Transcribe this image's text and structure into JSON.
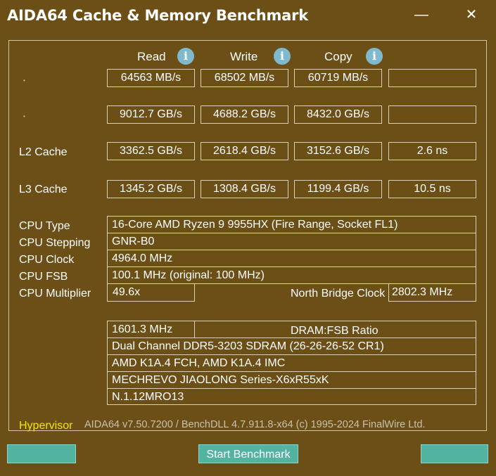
{
  "window": {
    "title": "AIDA64 Cache & Memory Benchmark",
    "minimize_symbol": "—",
    "close_symbol": "✕"
  },
  "columns": {
    "read": "Read",
    "write": "Write",
    "copy": "Copy",
    "info_symbol": "i"
  },
  "rows": {
    "memory": {
      "label": "",
      "read": "64563 MB/s",
      "write": "68502 MB/s",
      "copy": "60719 MB/s",
      "latency": ""
    },
    "l1": {
      "label": "",
      "read": "9012.7 GB/s",
      "write": "4688.2 GB/s",
      "copy": "8432.0 GB/s",
      "latency": ""
    },
    "l2": {
      "label": "L2 Cache",
      "read": "3362.5 GB/s",
      "write": "2618.4 GB/s",
      "copy": "3152.6 GB/s",
      "latency": "2.6 ns"
    },
    "l3": {
      "label": "L3 Cache",
      "read": "1345.2 GB/s",
      "write": "1308.4 GB/s",
      "copy": "1199.4 GB/s",
      "latency": "10.5 ns"
    }
  },
  "cpu": {
    "type_label": "CPU Type",
    "type": "16-Core AMD Ryzen 9 9955HX  (Fire Range, Socket FL1)",
    "stepping_label": "CPU Stepping",
    "stepping": "GNR-B0",
    "clock_label": "CPU Clock",
    "clock": "4964.0 MHz",
    "fsb_label": "CPU FSB",
    "fsb": "100.1 MHz  (original: 100 MHz)",
    "multiplier_label": "CPU Multiplier",
    "multiplier": "49.6x",
    "nb_clock_label": "North Bridge Clock",
    "nb_clock": "2802.3 MHz"
  },
  "memory_info": {
    "speed": "1601.3 MHz",
    "ratio_label": "DRAM:FSB Ratio",
    "type": "Dual Channel DDR5-3203 SDRAM  (26-26-26-52 CR1)",
    "chipset": "AMD K1A.4 FCH, AMD K1A.4 IMC",
    "motherboard": "MECHREVO JIAOLONG Series-X6xR55xK",
    "bios": "N.1.12MRO13"
  },
  "footer": {
    "hypervisor": "Hypervisor",
    "version": "AIDA64 v7.50.7200 / BenchDLL 4.7.911.8-x64  (c) 1995-2024 FinalWire Ltd."
  },
  "buttons": {
    "start": "Start Benchmark",
    "left": "",
    "right": ""
  },
  "colors": {
    "background": "#6b4f17",
    "button": "#52b3a0",
    "hypervisor": "#f5e400",
    "info": "#7fb9cd"
  }
}
